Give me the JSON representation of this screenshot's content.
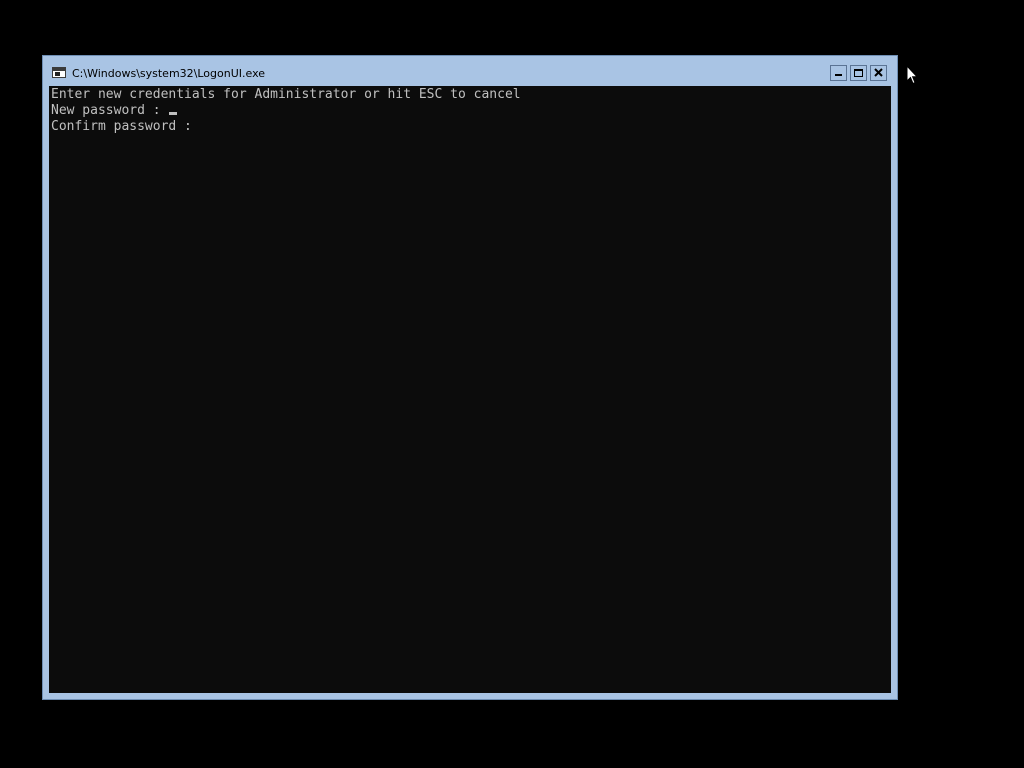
{
  "window": {
    "title": "C:\\Windows\\system32\\LogonUI.exe",
    "icon": "console-app-icon",
    "controls": {
      "minimize": "minimize-icon",
      "maximize": "maximize-icon",
      "close": "close-icon"
    }
  },
  "console": {
    "line1": "Enter new credentials for Administrator or hit ESC to cancel",
    "new_password_label": "New password : ",
    "confirm_password_label": "Confirm password :",
    "cursor_field": "new_password"
  },
  "colors": {
    "frame": "#a9c4e4",
    "console_bg": "#0c0c0c",
    "console_text": "#c0c0c0",
    "desktop": "#000000"
  }
}
